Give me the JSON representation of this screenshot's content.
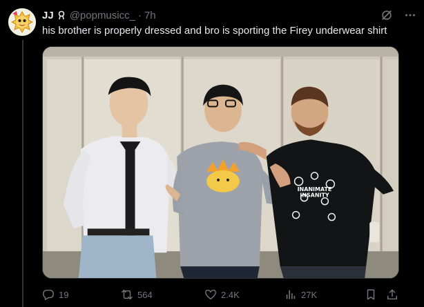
{
  "author": {
    "display_name": "JJ",
    "handle": "@popmusicc_",
    "separator": "·",
    "time": "7h",
    "badge_icon": "rune-badge-icon"
  },
  "tweet": {
    "text": "his brother is properly dressed and bro is sporting the Firey underwear shirt"
  },
  "media": {
    "shirt_logo_lines": [
      "INANIMATE",
      "INSANITY"
    ]
  },
  "actions": {
    "replies": "19",
    "reposts": "564",
    "likes": "2.4K",
    "views": "27K"
  },
  "colors": {
    "background": "#000000",
    "text_primary": "#e7e9ea",
    "text_secondary": "#71767b",
    "divider": "#2f3336"
  }
}
